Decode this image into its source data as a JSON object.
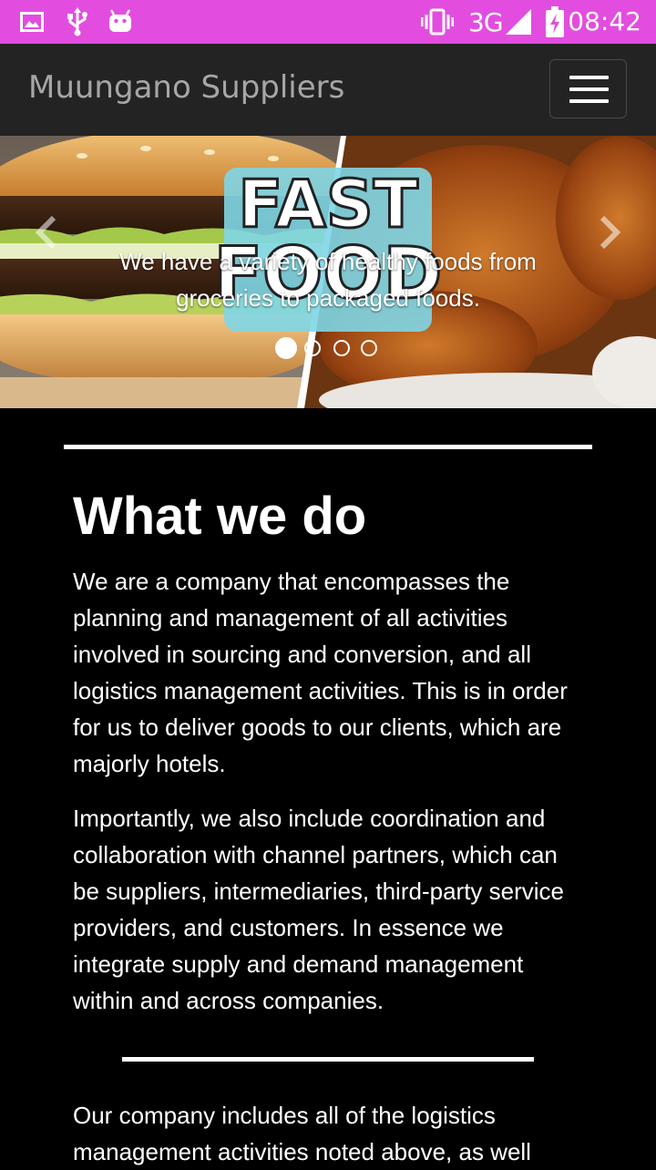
{
  "status_bar": {
    "network": "3G",
    "time": "08:42",
    "icons": [
      "gallery-icon",
      "usb-icon",
      "android-icon",
      "vibrate-icon",
      "signal-icon",
      "battery-charging-icon"
    ],
    "background_color": "#e24de0"
  },
  "navbar": {
    "brand": "Muungano Suppliers",
    "toggler_icon": "hamburger-menu-icon"
  },
  "carousel": {
    "image_text": [
      "FAST",
      "FOOD"
    ],
    "caption": "We have a variety of healthy foods from groceries to packaged foods.",
    "slide_count": 4,
    "active_index": 0,
    "prev_icon": "chevron-left-icon",
    "next_icon": "chevron-right-icon"
  },
  "section": {
    "heading": "What we do",
    "paragraphs": [
      "We are a company that encompasses the planning and management of all activities involved in sourcing and conversion, and all logistics management activities. This is in order for us to deliver goods to our clients, which are majorly hotels.",
      "Importantly, we also include coordination and collaboration with channel partners, which can be suppliers, intermediaries, third-party service providers, and customers. In essence we integrate supply and demand management within and across companies.",
      "Our company includes all of the logistics management activities noted above, as well"
    ]
  }
}
